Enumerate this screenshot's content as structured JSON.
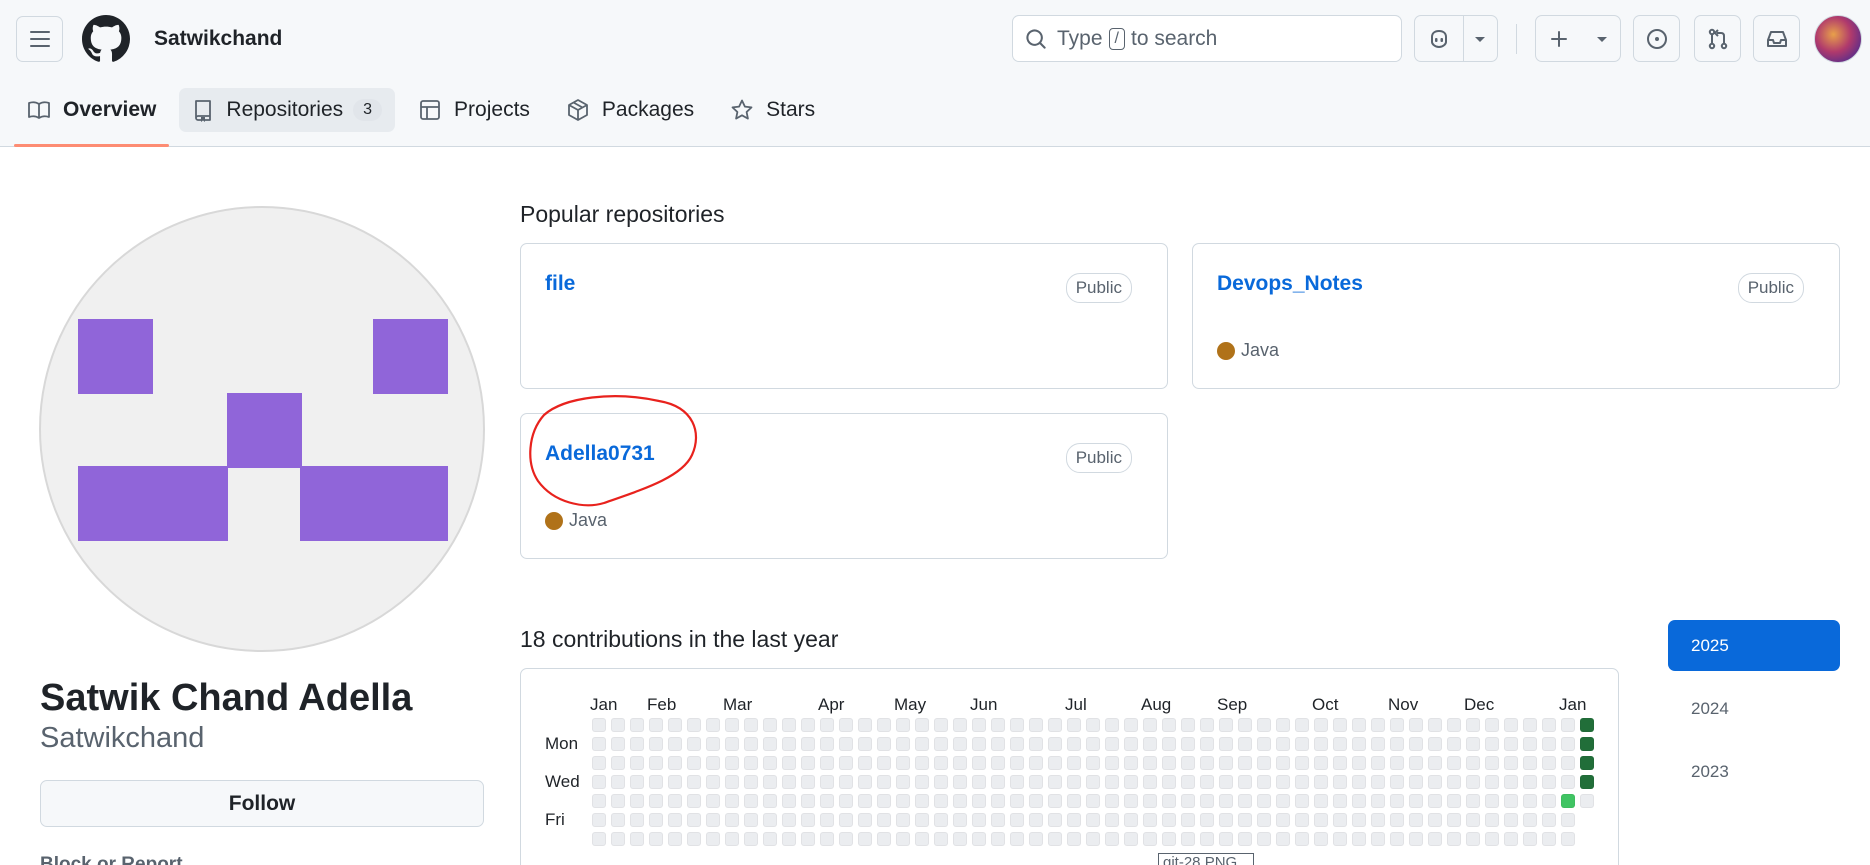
{
  "header": {
    "username": "Satwikchand",
    "search": {
      "prefix": "Type",
      "key": "/",
      "suffix": "to search"
    }
  },
  "tabs": [
    {
      "label": "Overview",
      "icon": "book-icon"
    },
    {
      "label": "Repositories",
      "icon": "repo-icon",
      "count": "3"
    },
    {
      "label": "Projects",
      "icon": "table-icon"
    },
    {
      "label": "Packages",
      "icon": "package-icon"
    },
    {
      "label": "Stars",
      "icon": "star-icon"
    }
  ],
  "profile": {
    "full_name": "Satwik Chand Adella",
    "login": "Satwikchand",
    "follow_label": "Follow",
    "block_label": "Block or Report",
    "identicon_color": "#9065d9"
  },
  "popular": {
    "title": "Popular repositories",
    "repos": [
      {
        "name": "file",
        "visibility": "Public",
        "language": ""
      },
      {
        "name": "Devops_Notes",
        "visibility": "Public",
        "language": "Java",
        "language_color": "#b07219"
      },
      {
        "name": "Adella0731",
        "visibility": "Public",
        "language": "Java",
        "language_color": "#b07219"
      }
    ]
  },
  "contributions": {
    "title": "18 contributions in the last year",
    "months": [
      "Jan",
      "Feb",
      "Mar",
      "Apr",
      "May",
      "Jun",
      "Jul",
      "Aug",
      "Sep",
      "Oct",
      "Nov",
      "Dec",
      "Jan"
    ],
    "days": [
      "Mon",
      "Wed",
      "Fri"
    ],
    "active_cells": [
      {
        "week": 51,
        "day": 4,
        "level": 2
      },
      {
        "week": 52,
        "day": 0,
        "level": 4
      },
      {
        "week": 52,
        "day": 1,
        "level": 4
      },
      {
        "week": 52,
        "day": 2,
        "level": 4
      },
      {
        "week": 52,
        "day": 3,
        "level": 4
      }
    ],
    "level_colors": [
      "#ebedf0",
      "#9be9a8",
      "#40c463",
      "#30a14e",
      "#216e39"
    ],
    "tooltip": "git-28.PNG"
  },
  "years": [
    "2025",
    "2024",
    "2023"
  ],
  "selected_year": "2025"
}
